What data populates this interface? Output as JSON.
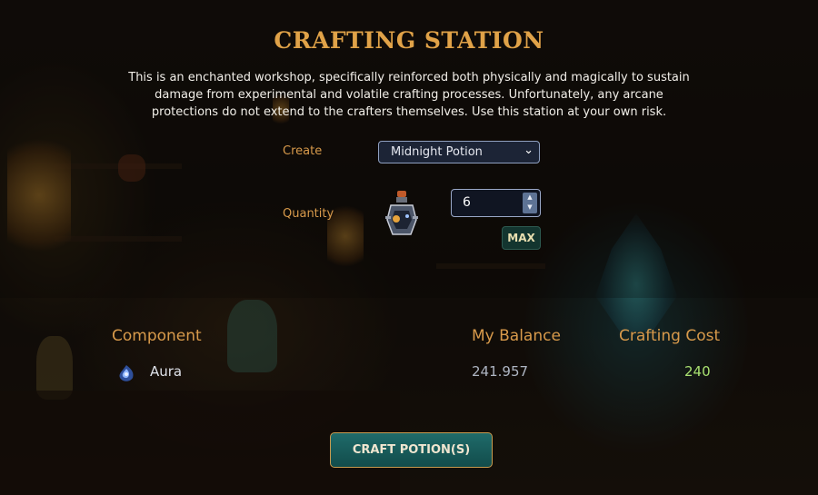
{
  "header": {
    "title": "CRAFTING STATION",
    "description": "This is an enchanted workshop, specifically reinforced both physically and magically to sustain damage from experimental and volatile crafting processes. Unfortunately, any arcane protections do not extend to the crafters themselves. Use this station at your own risk."
  },
  "form": {
    "create_label": "Create",
    "create_value": "Midnight Potion",
    "quantity_label": "Quantity",
    "quantity_value": "6",
    "max_label": "MAX"
  },
  "components": {
    "headers": {
      "component": "Component",
      "balance": "My Balance",
      "cost": "Crafting Cost"
    },
    "rows": [
      {
        "name": "Aura",
        "icon": "aura-icon",
        "balance": "241.957",
        "cost": "240"
      }
    ]
  },
  "actions": {
    "craft_label": "CRAFT POTION(S)"
  },
  "colors": {
    "accent": "#e0a248",
    "label": "#d89a4b",
    "cost": "#a8e070",
    "button": "#1a5e5d"
  }
}
